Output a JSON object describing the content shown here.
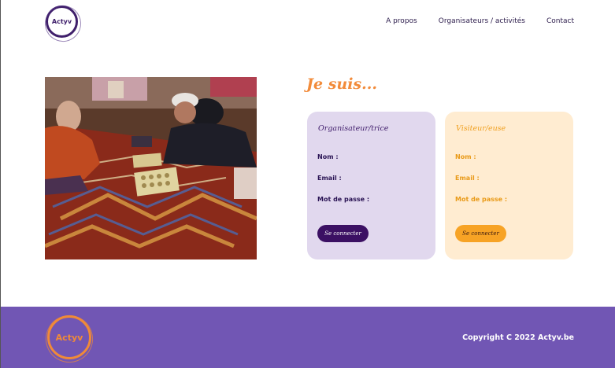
{
  "header": {
    "logo_text": "Actyv",
    "nav": [
      "A propos",
      "Organisateurs / activités",
      "Contact"
    ]
  },
  "main": {
    "heading": "Je suis...",
    "cards": [
      {
        "title": "Organisateur/trice",
        "fields": [
          "Nom :",
          "Email :",
          "Mot de passe :"
        ],
        "button": "Se connecter"
      },
      {
        "title": "Visiteur/euse",
        "fields": [
          "Nom :",
          "Email :",
          "Mot de passe :"
        ],
        "button": "Se connecter"
      }
    ]
  },
  "footer": {
    "logo_text": "Actyv",
    "copyright": "Copyright C 2022 Actyv.be"
  },
  "colors": {
    "brand_purple": "#3f1f6b",
    "footer_purple": "#7156b4",
    "accent_orange": "#f28b3a",
    "card_purple_bg": "#e1d8ee",
    "card_orange_bg": "#ffecd1"
  }
}
